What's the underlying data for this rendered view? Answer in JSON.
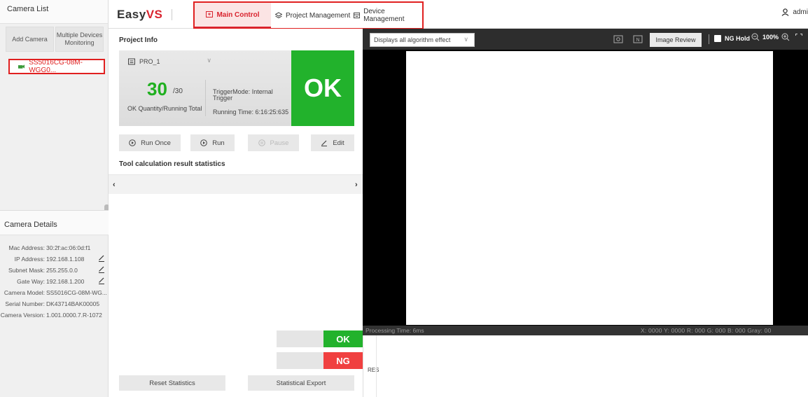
{
  "left_panel": {
    "title": "Camera List",
    "add_camera": "Add Camera",
    "multiple_monitoring": "Multiple Devices Monitoring",
    "camera_item": "SS5016CG-08M-WGG0...",
    "details_title": "Camera Details",
    "details": [
      {
        "label": "Mac Address:",
        "value": "30:2f:ac:06:0d:f1",
        "editable": false
      },
      {
        "label": "IP Address:",
        "value": "192.168.1.108",
        "editable": true
      },
      {
        "label": "Subnet Mask:",
        "value": "255.255.0.0",
        "editable": true
      },
      {
        "label": "Gate Way:",
        "value": "192.168.1.200",
        "editable": true
      },
      {
        "label": "Camera Model:",
        "value": "SS5016CG-08M-WG...",
        "editable": false
      },
      {
        "label": "Serial Number:",
        "value": "DK43714BAK00005",
        "editable": false
      },
      {
        "label": "Camera Version:",
        "value": "1.001.0000.7.R-1072",
        "editable": false
      }
    ]
  },
  "header": {
    "logo_easy": "Easy",
    "logo_vs": "VS",
    "tabs": [
      {
        "label": "Main Control",
        "active": true,
        "icon": "monitor-icon"
      },
      {
        "label": "Project Management",
        "active": false,
        "icon": "layers-icon"
      },
      {
        "label": "Device Management",
        "active": false,
        "icon": "device-icon"
      }
    ],
    "user": "admi"
  },
  "project_info": {
    "title": "Project Info",
    "project": "PRO_1",
    "ok_count": "30",
    "total": "/30",
    "ok_quantity_label": "OK Quantity/Running Total",
    "trigger_mode": "TriggerMode: Internal Trigger",
    "running_time": "Running Time: 6:16:25:635",
    "status": "OK"
  },
  "controls": {
    "run_once": "Run Once",
    "run": "Run",
    "pause": "Pause",
    "edit": "Edit"
  },
  "tool_stats": {
    "title": "Tool calculation result statistics",
    "prev": "‹",
    "next": "›"
  },
  "results": {
    "ok": "OK",
    "ng": "NG",
    "reset": "Reset Statistics",
    "export": "Statistical Export"
  },
  "viewer": {
    "display_select": "Displays all algorithm effect",
    "image_review": "Image Review",
    "ng_hold": "NG Hold",
    "zoom": "100%",
    "processing_time": "Processing Time: 6ms",
    "coords": "X: 0000   Y: 0000   R: 000   G: 000   B: 000   Gray: 00",
    "log_label": "RES"
  },
  "colors": {
    "accent": "#d9232e",
    "ok": "#22b22c",
    "ng": "#f04040"
  }
}
